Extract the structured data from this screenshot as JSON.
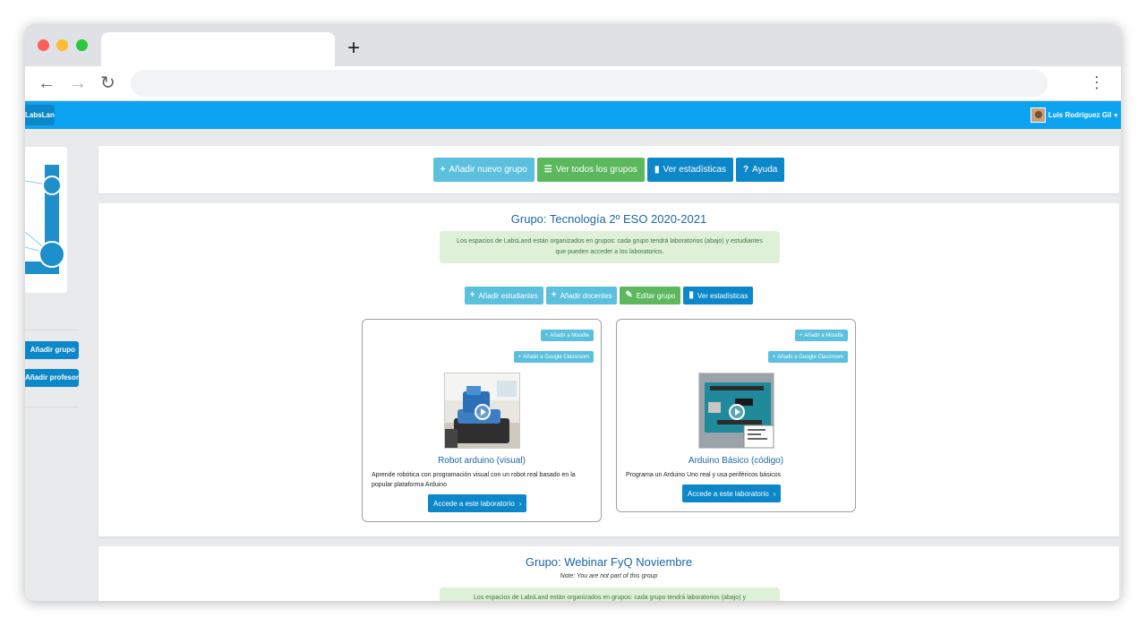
{
  "browser": {
    "new_tab_label": "+",
    "back_icon": "←",
    "forward_icon": "→",
    "reload_icon": "↻",
    "menu_icon": "⋮"
  },
  "navbar": {
    "brand": "LabsLand",
    "user_name": "Luis Rodríguez Gil",
    "caret": "▾"
  },
  "sidebar": {
    "buttons": [
      {
        "label": "Añadir grupo"
      },
      {
        "label": "Añadir profesor"
      }
    ]
  },
  "toolbar": {
    "buttons": [
      {
        "label": "Añadir nuevo grupo",
        "icon": "+",
        "color": "#5bc0de"
      },
      {
        "label": "Ver todos los grupos",
        "icon": "☰",
        "color": "#5cb85c"
      },
      {
        "label": "Ver estadísticas",
        "icon": "▮",
        "color": "#0c87c9"
      },
      {
        "label": "Ayuda",
        "icon": "?",
        "color": "#0c87c9"
      }
    ]
  },
  "group1": {
    "title": "Grupo: Tecnología 2º ESO 2020-2021",
    "info": "Los espacios de LabsLand están organizados en grupos: cada grupo tendrá laboratorios (abajo) y estudiantes que pueden acceder a los laboratorios.",
    "actions": [
      {
        "label": "Añadir estudiantes",
        "icon": "+"
      },
      {
        "label": "Añadir docentes",
        "icon": "+"
      },
      {
        "label": "Editar grupo",
        "icon": "✎"
      },
      {
        "label": "Ver estadísticas",
        "icon": "▮"
      }
    ],
    "labs": [
      {
        "title": "Robot arduino (visual)",
        "description": "Aprende robótica con programación visual con un robot real basado en la popular plataforma Arduino",
        "moodle": "Añadir a Moodle",
        "classroom": "Añadir a Google Classroom",
        "access": "Accede a este laboratorio",
        "access_icon": "›"
      },
      {
        "title": "Arduino Básico (código)",
        "description": "Programa un Arduino Uno real y usa periféricos básicos",
        "moodle": "Añadir a Moodle",
        "classroom": "Añadir a Google Classroom",
        "access": "Accede a este laboratorio",
        "access_icon": "›"
      }
    ]
  },
  "group2": {
    "title": "Grupo: Webinar FyQ Noviembre",
    "note": "Note: You are not part of this group",
    "info": "Los espacios de LabsLand están organizados en grupos: cada grupo tendrá laboratorios (abajo) y"
  }
}
